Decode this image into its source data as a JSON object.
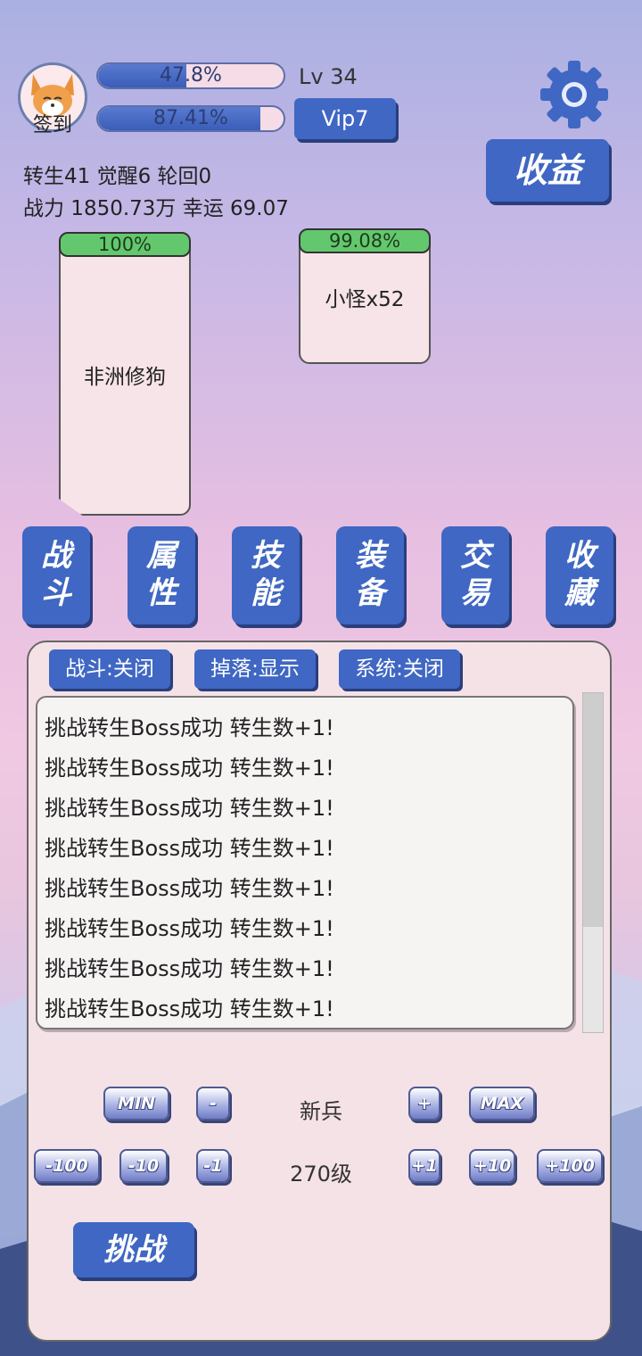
{
  "header": {
    "signin_label": "签到",
    "avatar_icon": "corgi-avatar-icon",
    "exp_bar": {
      "text": "47.8%",
      "fraction": 0.478
    },
    "hp_bar": {
      "text": "87.41%",
      "fraction": 0.8741
    },
    "level": "Lv 34",
    "vip_label": "Vip7",
    "settings_icon": "gear-icon",
    "income_label": "收益"
  },
  "stats": {
    "line1": "转生41 觉醒6 轮回0",
    "line2": "战力 1850.73万  幸运 69.07"
  },
  "cards": {
    "player": {
      "hp_text": "100%",
      "name": "非洲修狗"
    },
    "enemy": {
      "hp_text": "99.08%",
      "name": "小怪x52"
    }
  },
  "nav": [
    {
      "label_line1": "战",
      "label_line2": "斗"
    },
    {
      "label_line1": "属",
      "label_line2": "性"
    },
    {
      "label_line1": "技",
      "label_line2": "能"
    },
    {
      "label_line1": "装",
      "label_line2": "备"
    },
    {
      "label_line1": "交",
      "label_line2": "易"
    },
    {
      "label_line1": "收",
      "label_line2": "藏"
    }
  ],
  "filters": {
    "battle": "战斗:关闭",
    "drops": "掉落:显示",
    "system": "系统:关闭"
  },
  "log": [
    "挑战转生Boss成功 转生数+1!",
    "挑战转生Boss成功 转生数+1!",
    "挑战转生Boss成功 转生数+1!",
    "挑战转生Boss成功 转生数+1!",
    "挑战转生Boss成功 转生数+1!",
    "挑战转生Boss成功 转生数+1!",
    "挑战转生Boss成功 转生数+1!",
    "挑战转生Boss成功 转生数+1!"
  ],
  "selector": {
    "monster_type": "新兵",
    "level": "270级",
    "min_label": "MIN",
    "minus_label": "-",
    "plus_label": "+",
    "max_label": "MAX",
    "minus100": "-100",
    "minus10": "-10",
    "minus1": "-1",
    "plus1": "+1",
    "plus10": "+10",
    "plus100": "+100"
  },
  "challenge_label": "挑战",
  "colors": {
    "button_blue": "#3f67c3",
    "hp_green": "#63c86d",
    "panel_pink": "#f5e2e7"
  }
}
